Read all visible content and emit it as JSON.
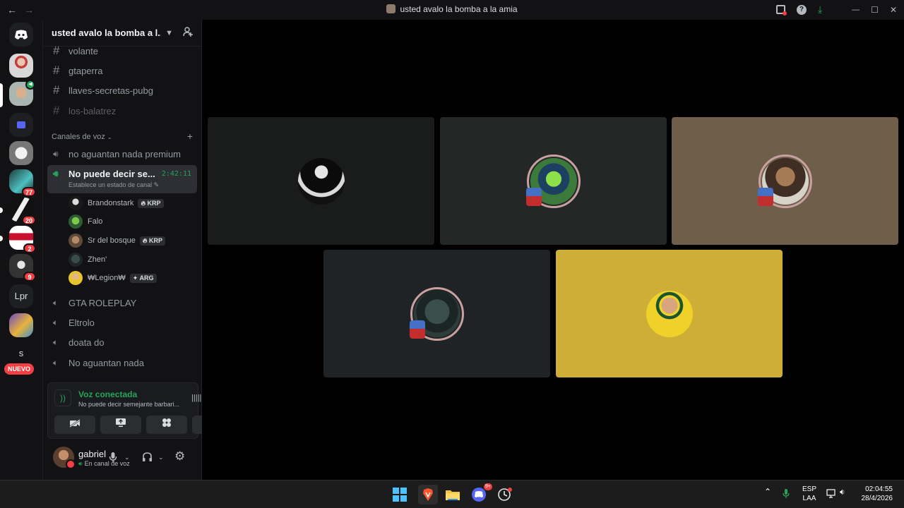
{
  "window": {
    "title": "usted avalo la bomba a la amia",
    "nav_back": "←",
    "nav_forward": "→",
    "controls": {
      "minimize": "—",
      "maximize": "☐",
      "close": "✕"
    }
  },
  "guilds": {
    "nuevo_label": "NUEVO",
    "badges": [
      "77",
      "20",
      "2",
      "9"
    ],
    "text_server": "Lpr",
    "text_server2": "s"
  },
  "server": {
    "name": "usted avalo la bomba a l...",
    "text_channels": [
      "volante",
      "gtaperra",
      "llaves-secretas-pubg",
      "los-balatrez"
    ],
    "voice_category": "Canales de voz",
    "voice_channels_top": [
      "no aguantan nada premium"
    ],
    "active_voice": {
      "name": "No puede decir se...",
      "timer": "2:42:11",
      "status": "Establece un estado de canal"
    },
    "members": [
      {
        "name": "Brandonstark",
        "tag": "KRP"
      },
      {
        "name": "Falo",
        "tag": ""
      },
      {
        "name": "Sr del bosque",
        "tag": "KRP"
      },
      {
        "name": "Zhen'",
        "tag": ""
      },
      {
        "name": "₩Legion₩",
        "tag": "ARG"
      }
    ],
    "voice_channels_bottom": [
      "GTA ROLEPLAY",
      "Eltrolo",
      "doata do",
      "No aguantan nada"
    ]
  },
  "voice_panel": {
    "title": "Voz conectada",
    "subtitle": "No puede decir semejante barbari..."
  },
  "user": {
    "name": "gabriel",
    "status": "En canal de voz"
  },
  "taskbar": {
    "lang": "ESP",
    "layout": "LAA",
    "time": "02:04:55",
    "date": "28/4/2026",
    "discord_badge": "9+"
  },
  "colors": {
    "accent_green": "#23a55a",
    "danger_red": "#f23f43",
    "tile_gray": "#1a1c1c",
    "tile_dark_green": "#232826",
    "tile_tan": "#6f5f4a",
    "tile_dark_teal": "#1f2325",
    "tile_yellow": "#cfae37"
  }
}
